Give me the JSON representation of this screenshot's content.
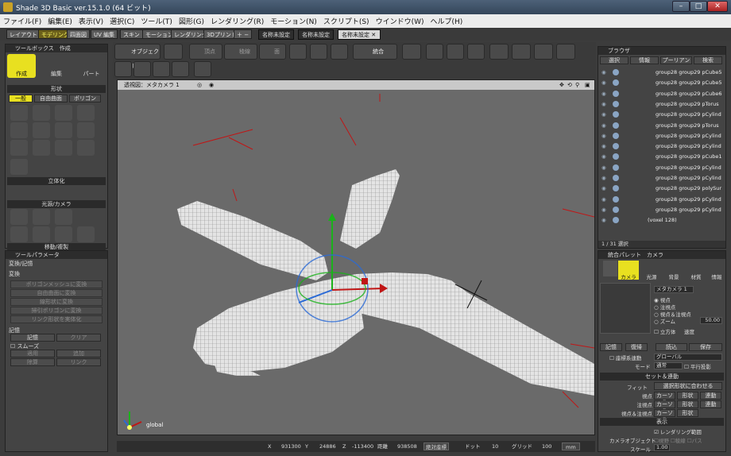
{
  "window": {
    "title": "Shade 3D Basic ver.15.1.0 (64 ビット)"
  },
  "menu": [
    "ファイル(F)",
    "編集(E)",
    "表示(V)",
    "選択(C)",
    "ツール(T)",
    "図形(G)",
    "レンダリング(R)",
    "モーション(N)",
    "スクリプト(S)",
    "ウインドウ(W)",
    "ヘルプ(H)"
  ],
  "workspace_tabs": [
    "レイアウト",
    "モデリング",
    "四面図",
    "UV 編集",
    "スキン",
    "モーション",
    "レンダリング",
    "3Dプリント",
    "＋ −"
  ],
  "active_workspace": "モデリング",
  "doc_tabs": [
    "名称未設定",
    "名称未設定",
    "名称未設定"
  ],
  "toolbox": {
    "title": "ツールボックス　作成",
    "modes": [
      "作成",
      "編集",
      "パート"
    ],
    "shape_header": "形状",
    "shape_tabs": [
      "一般",
      "自由曲面",
      "ポリゴン"
    ],
    "solidify": "立体化",
    "light_camera": "光源/カメラ",
    "move_copy": "移動/複製"
  },
  "toolparams": {
    "title": "ツールパラメータ",
    "subtitle": "変換/記憶",
    "convert_label": "変換",
    "convert_buttons": [
      "ポリゴンメッシュに変換",
      "自由曲面に変換",
      "線形状に変換",
      "掃引ポリゴンに変換",
      "リンク形状を実体化"
    ],
    "memory_label": "記憶",
    "memory_row1": [
      "記憶",
      "クリア"
    ],
    "smooth": "スムーズ",
    "memory_row2": [
      "適用",
      "追加"
    ],
    "memory_row3": [
      "除算",
      "リンク"
    ]
  },
  "maintoolbar": {
    "object_label": "オブジェクト",
    "vertex": "頂点",
    "edge": "稜線",
    "face": "面",
    "unify": "統合"
  },
  "viewport": {
    "label": "透視図：メタカメラ 1",
    "axis_label": "global"
  },
  "status": {
    "x_label": "X",
    "x": "931300",
    "y_label": "Y",
    "y": "24886",
    "z_label": "Z",
    "z": "-113400",
    "dist_label": "距離",
    "dist": "938508",
    "coord": "絶対座標",
    "dot_label": "ドット",
    "dot": "10",
    "grid_label": "グリッド",
    "grid": "100",
    "unit": "mm"
  },
  "browser": {
    "title": "ブラウザ",
    "tabs": [
      "選択",
      "情報",
      "プーリアン",
      "検索"
    ],
    "rows": [
      "group28 group29 pCube5",
      "group28 group29 pCube5",
      "group28 group29 pCube6",
      "group28 group29 pTorus",
      "group28 group29 pCylind",
      "group28 group29 pTorus",
      "group28 group29 pCylind",
      "group28 group29 pCylind",
      "group28 group29 pCube1",
      "group28 group29 pCylind",
      "group28 group29 pCylind",
      "group28 group29 polySur",
      "group28 group29 pCylind",
      "group28 group29 pCylind",
      "(voxel 128)"
    ],
    "count": "1 / 31 選択"
  },
  "palette": {
    "title": "統合パレット　カメラ",
    "icons": [
      "カメラ",
      "光源",
      "背景",
      "材質",
      "情報"
    ],
    "camera_name": "メタカメラ 1",
    "radio": [
      "視点",
      "注視点",
      "視点＆注視点",
      "ズーム"
    ],
    "zoom_value": "50.00",
    "cube_label": "立方体",
    "speed_label": "速度",
    "buttons": [
      "記憶",
      "復帰",
      "読込",
      "保存"
    ],
    "coord_system": "座標系連動",
    "coord_value": "グローバル",
    "mode_label": "モード",
    "mode_value": "通常",
    "parallel": "平行投影",
    "set_header": "セット＆連動",
    "fit_label": "フィット",
    "fit_value": "選択形状に合わせる",
    "rows": [
      {
        "label": "視点",
        "btns": [
          "カーソル",
          "形状",
          "連動"
        ]
      },
      {
        "label": "注視点",
        "btns": [
          "カーソル",
          "形状",
          "連動"
        ]
      },
      {
        "label": "視点＆注視点",
        "btns": [
          "カーソル",
          "形状"
        ]
      }
    ],
    "display_header": "表示",
    "render_range": "レンダリング範囲",
    "cam_obj_label": "カメラオブジェクト",
    "cam_obj_opts": [
      "視野",
      "稜線",
      "パス"
    ],
    "scale_label": "スケール",
    "scale_value": "1.00"
  }
}
